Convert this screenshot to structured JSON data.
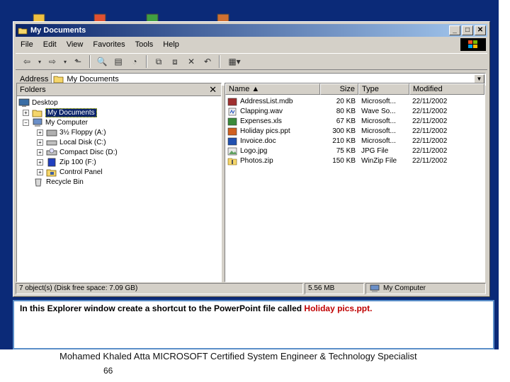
{
  "window": {
    "title": "My Documents"
  },
  "menu": [
    "File",
    "Edit",
    "View",
    "Favorites",
    "Tools",
    "Help"
  ],
  "address": {
    "label": "Address",
    "value": "My Documents"
  },
  "folders": {
    "title": "Folders",
    "close": "✕",
    "tree": [
      {
        "label": "Desktop",
        "icon": "desktop-icon"
      },
      {
        "label": "My Documents",
        "icon": "folder-open-icon",
        "selected": true
      },
      {
        "label": "My Computer",
        "icon": "computer-icon"
      },
      {
        "label": "3½ Floppy (A:)",
        "icon": "floppy-drive-icon"
      },
      {
        "label": "Local Disk (C:)",
        "icon": "hard-disk-icon"
      },
      {
        "label": "Compact Disc (D:)",
        "icon": "cd-drive-icon"
      },
      {
        "label": "Zip 100  (F:)",
        "icon": "zip-drive-icon"
      },
      {
        "label": "Control Panel",
        "icon": "control-panel-icon"
      },
      {
        "label": "Recycle Bin",
        "icon": "recycle-bin-icon"
      }
    ]
  },
  "files": {
    "columns": [
      "Name",
      "Size",
      "Type",
      "Modified"
    ],
    "rows": [
      {
        "name": "AddressList.mdb",
        "size": "20 KB",
        "type": "Microsoft...",
        "modified": "22/11/2002",
        "icon": "access-file-icon"
      },
      {
        "name": "Clapping.wav",
        "size": "80 KB",
        "type": "Wave So...",
        "modified": "22/11/2002",
        "icon": "wave-file-icon"
      },
      {
        "name": "Expenses.xls",
        "size": "67 KB",
        "type": "Microsoft...",
        "modified": "22/11/2002",
        "icon": "excel-file-icon"
      },
      {
        "name": "Holiday pics.ppt",
        "size": "300 KB",
        "type": "Microsoft...",
        "modified": "22/11/2002",
        "icon": "powerpoint-file-icon"
      },
      {
        "name": "Invoice.doc",
        "size": "210 KB",
        "type": "Microsoft...",
        "modified": "22/11/2002",
        "icon": "word-file-icon"
      },
      {
        "name": "Logo.jpg",
        "size": "75 KB",
        "type": "JPG File",
        "modified": "22/11/2002",
        "icon": "image-file-icon"
      },
      {
        "name": "Photos.zip",
        "size": "150 KB",
        "type": "WinZip File",
        "modified": "22/11/2002",
        "icon": "zip-file-icon"
      }
    ]
  },
  "status": {
    "objects": "7 object(s) (Disk free space: 7.09 GB)",
    "size": "5.56 MB",
    "location": "My Computer"
  },
  "instruction": {
    "text": "In this Explorer window create a shortcut to the PowerPoint file called ",
    "highlight": "Holiday pics.ppt."
  },
  "footer": {
    "text": "Mohamed Khaled Atta MICROSOFT Certified System Engineer & Technology Specialist",
    "page": "66"
  },
  "colors": {
    "titlebar": "#0a246a",
    "selection": "#0a246a",
    "highlight_text": "#c00000",
    "desktop": "#0b2a78"
  }
}
